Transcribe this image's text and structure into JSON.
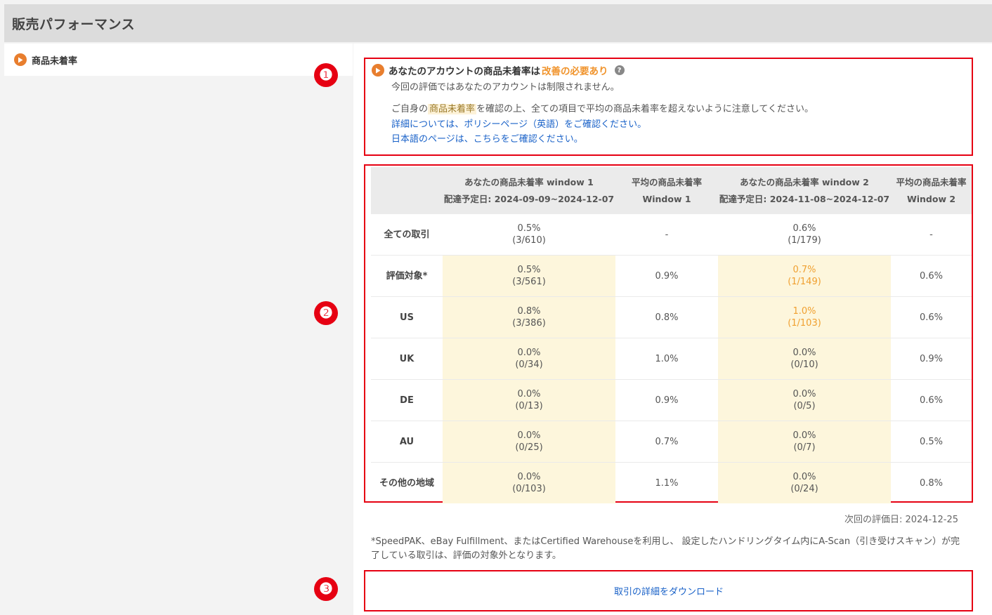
{
  "page": {
    "title": "販売パフォーマンス"
  },
  "sidebar": {
    "items": [
      {
        "label": "商品未着率",
        "icon": "play-circle-icon"
      }
    ]
  },
  "markers": [
    "❶",
    "❷",
    "❸"
  ],
  "notice": {
    "headline_prefix": "あなたのアカウントの商品未着率は",
    "headline_status": "改善の必要あり",
    "help_icon": "?",
    "subtext": "今回の評価ではあなたのアカウントは制限されません。",
    "body_prefix": "ご自身の",
    "body_term": "商品未着率",
    "body_suffix": "を確認の上、全ての項目で平均の商品未着率を超えないように注意してください。",
    "link_policy": "詳細については、ポリシーページ（英語）をご確認ください。",
    "link_japanese": "日本語のページは、こちらをご確認ください。"
  },
  "table": {
    "headers": [
      {
        "line1": "",
        "line2": ""
      },
      {
        "line1": "あなたの商品未着率 window 1",
        "line2": "配達予定日: 2024-09-09~2024-12-07"
      },
      {
        "line1": "平均の商品未着率",
        "line2": "Window 1"
      },
      {
        "line1": "あなたの商品未着率 window 2",
        "line2": "配達予定日: 2024-11-08~2024-12-07"
      },
      {
        "line1": "平均の商品未着率",
        "line2": "Window 2"
      }
    ],
    "rows": [
      {
        "label": "全ての取引",
        "w1_rate": "0.5%",
        "w1_count": "(3/610)",
        "avg1": "-",
        "w2_rate": "0.6%",
        "w2_count": "(1/179)",
        "avg2": "-"
      },
      {
        "label": "評価対象*",
        "w1_rate": "0.5%",
        "w1_count": "(3/561)",
        "avg1": "0.9%",
        "w2_rate": "0.7%",
        "w2_count": "(1/149)",
        "avg2": "0.6%"
      },
      {
        "label": "US",
        "w1_rate": "0.8%",
        "w1_count": "(3/386)",
        "avg1": "0.8%",
        "w2_rate": "1.0%",
        "w2_count": "(1/103)",
        "avg2": "0.6%"
      },
      {
        "label": "UK",
        "w1_rate": "0.0%",
        "w1_count": "(0/34)",
        "avg1": "1.0%",
        "w2_rate": "0.0%",
        "w2_count": "(0/10)",
        "avg2": "0.9%"
      },
      {
        "label": "DE",
        "w1_rate": "0.0%",
        "w1_count": "(0/13)",
        "avg1": "0.9%",
        "w2_rate": "0.0%",
        "w2_count": "(0/5)",
        "avg2": "0.6%"
      },
      {
        "label": "AU",
        "w1_rate": "0.0%",
        "w1_count": "(0/25)",
        "avg1": "0.7%",
        "w2_rate": "0.0%",
        "w2_count": "(0/7)",
        "avg2": "0.5%"
      },
      {
        "label": "その他の地域",
        "w1_rate": "0.0%",
        "w1_count": "(0/103)",
        "avg1": "1.1%",
        "w2_rate": "0.0%",
        "w2_count": "(0/24)",
        "avg2": "0.8%"
      }
    ]
  },
  "next_evaluation": "次回の評価日: 2024-12-25",
  "footnote": "*SpeedPAK、eBay Fulfillment、またはCertified Warehouseを利用し、 設定したハンドリングタイム内にA-Scan（引き受けスキャン）が完了している取引は、評価の対象外となります。",
  "download": {
    "label": "取引の詳細をダウンロード"
  },
  "colors": {
    "accent_orange": "#e87e2e",
    "warning_orange": "#f0a030",
    "annotation_red": "#e60012",
    "link_blue": "#1a62c8",
    "highlight_cell": "#fdf6dc"
  }
}
